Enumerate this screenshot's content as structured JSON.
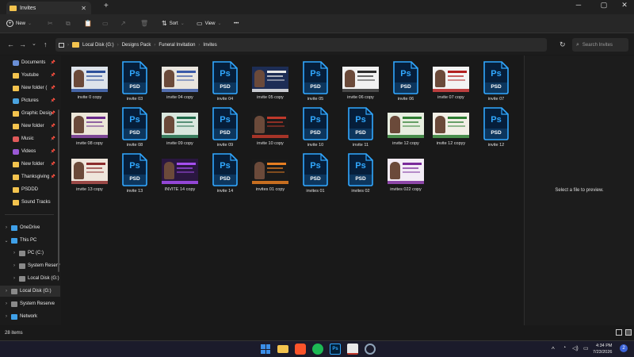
{
  "window": {
    "tab_title": "Invites",
    "new_tab": "+",
    "tab_close": "✕",
    "controls": {
      "minimize": "─",
      "maximize": "▢",
      "close": "✕"
    }
  },
  "toolbar": {
    "new_label": "New",
    "sort_label": "Sort",
    "view_label": "View",
    "more_label": "•••"
  },
  "address": {
    "crumbs": [
      "Local Disk (G:)",
      "Designs Pack",
      "Funeral Invitation",
      "Invites"
    ],
    "search_placeholder": "Search Invites"
  },
  "sidebar": {
    "quick": [
      {
        "label": "Documents",
        "icon": "document-icon",
        "color": "#6a8fd6",
        "pinned": true
      },
      {
        "label": "Youtube",
        "icon": "folder-icon",
        "color": "#f3c34e",
        "pinned": true
      },
      {
        "label": "New folder (",
        "icon": "folder-icon",
        "color": "#f3c34e",
        "pinned": true
      },
      {
        "label": "Pictures",
        "icon": "pictures-icon",
        "color": "#4aa3df",
        "pinned": true
      },
      {
        "label": "Graphic Desig",
        "icon": "folder-icon",
        "color": "#f3c34e",
        "pinned": true
      },
      {
        "label": "New folder",
        "icon": "folder-icon",
        "color": "#f3c34e",
        "pinned": true
      },
      {
        "label": "Music",
        "icon": "music-icon",
        "color": "#e05a5a",
        "pinned": true
      },
      {
        "label": "Videos",
        "icon": "videos-icon",
        "color": "#9b59d6",
        "pinned": true
      },
      {
        "label": "New folder",
        "icon": "folder-icon",
        "color": "#f3c34e",
        "pinned": true
      },
      {
        "label": "Thanksgiving",
        "icon": "folder-icon",
        "color": "#f3c34e",
        "pinned": true
      },
      {
        "label": "PSDDD",
        "icon": "folder-icon",
        "color": "#f3c34e",
        "pinned": false
      },
      {
        "label": "Sound Tracks",
        "icon": "folder-icon",
        "color": "#f3c34e",
        "pinned": false
      }
    ],
    "tree": [
      {
        "label": "OneDrive",
        "icon": "onedrive-icon",
        "color": "#3fa0e8",
        "expanded": false,
        "indent": 0
      },
      {
        "label": "This PC",
        "icon": "pc-icon",
        "color": "#3fa0e8",
        "expanded": true,
        "indent": 0
      },
      {
        "label": "PC (C:)",
        "icon": "drive-icon",
        "color": "#8a8a8a",
        "expanded": false,
        "indent": 1
      },
      {
        "label": "System Reserv",
        "icon": "drive-icon",
        "color": "#8a8a8a",
        "expanded": false,
        "indent": 1
      },
      {
        "label": "Local Disk (G:)",
        "icon": "drive-icon",
        "color": "#8a8a8a",
        "expanded": false,
        "indent": 1
      },
      {
        "label": "Local Disk (G:)",
        "icon": "drive-icon",
        "color": "#8a8a8a",
        "expanded": false,
        "indent": 0,
        "selected": true
      },
      {
        "label": "System Reserve",
        "icon": "drive-icon",
        "color": "#8a8a8a",
        "expanded": false,
        "indent": 0
      },
      {
        "label": "Network",
        "icon": "network-icon",
        "color": "#3fa0e8",
        "expanded": false,
        "indent": 0
      }
    ]
  },
  "files": [
    {
      "name": "invite 0 copy",
      "kind": "img",
      "bg": "#dde3ea",
      "accent": "#2c4f9a"
    },
    {
      "name": "invite 03",
      "kind": "psd"
    },
    {
      "name": "invite 04 copy",
      "kind": "img",
      "bg": "#e9e5de",
      "accent": "#3a5aa8"
    },
    {
      "name": "invite 04",
      "kind": "psd"
    },
    {
      "name": "invite 05 copy",
      "kind": "img",
      "bg": "#1d2d55",
      "accent": "#e8e8e8"
    },
    {
      "name": "invite 05",
      "kind": "psd"
    },
    {
      "name": "invite 06 copy",
      "kind": "img",
      "bg": "#f1f1f1",
      "accent": "#2b2b2b"
    },
    {
      "name": "invite 06",
      "kind": "psd"
    },
    {
      "name": "invite 07 copy",
      "kind": "img",
      "bg": "#f3f3f3",
      "accent": "#b21f1f"
    },
    {
      "name": "invite 07",
      "kind": "psd"
    },
    {
      "name": "invite 08 copy",
      "kind": "img",
      "bg": "#ece6d8",
      "accent": "#6a2a8a"
    },
    {
      "name": "invite 08",
      "kind": "psd"
    },
    {
      "name": "invite 09 copy",
      "kind": "img",
      "bg": "#d9e7de",
      "accent": "#1f6b4a"
    },
    {
      "name": "invite 09",
      "kind": "psd"
    },
    {
      "name": "invite 10 copy",
      "kind": "img",
      "bg": "#1a1a1a",
      "accent": "#c0392b"
    },
    {
      "name": "invite 10",
      "kind": "psd"
    },
    {
      "name": "invite 11",
      "kind": "psd"
    },
    {
      "name": "invite 12 copy",
      "kind": "img",
      "bg": "#e7eee0",
      "accent": "#2e7d32"
    },
    {
      "name": "invite 12 copyy",
      "kind": "img",
      "bg": "#f2efe6",
      "accent": "#2e7d32"
    },
    {
      "name": "invite 12",
      "kind": "psd"
    },
    {
      "name": "invite 13 copy",
      "kind": "img",
      "bg": "#efe6dc",
      "accent": "#8b2c2c"
    },
    {
      "name": "invite 13",
      "kind": "psd"
    },
    {
      "name": "INVITE 14 copy",
      "kind": "img",
      "bg": "#2a1740",
      "accent": "#a64ff0"
    },
    {
      "name": "invite 14",
      "kind": "psd"
    },
    {
      "name": "invites 01 copy",
      "kind": "img",
      "bg": "#1a1a1a",
      "accent": "#e67e22"
    },
    {
      "name": "invites 01",
      "kind": "psd"
    },
    {
      "name": "invites 02",
      "kind": "psd"
    },
    {
      "name": "invites 022 copy",
      "kind": "img",
      "bg": "#f3ecf6",
      "accent": "#7a2a9a"
    }
  ],
  "psd_icon": {
    "top": "Ps",
    "bottom": "PSD"
  },
  "preview": {
    "text": "Select a file to preview."
  },
  "status": {
    "item_count": "28 items"
  },
  "taskbar": {
    "time": "4:34 PM",
    "date": "7/23/2026",
    "tray_up": "^",
    "notification_count": "2",
    "accent": "#3b63d8"
  },
  "colors": {
    "psd_blue": "#31a8ff",
    "psd_bg": "#061e3a",
    "selection": "#2e2e2e"
  }
}
